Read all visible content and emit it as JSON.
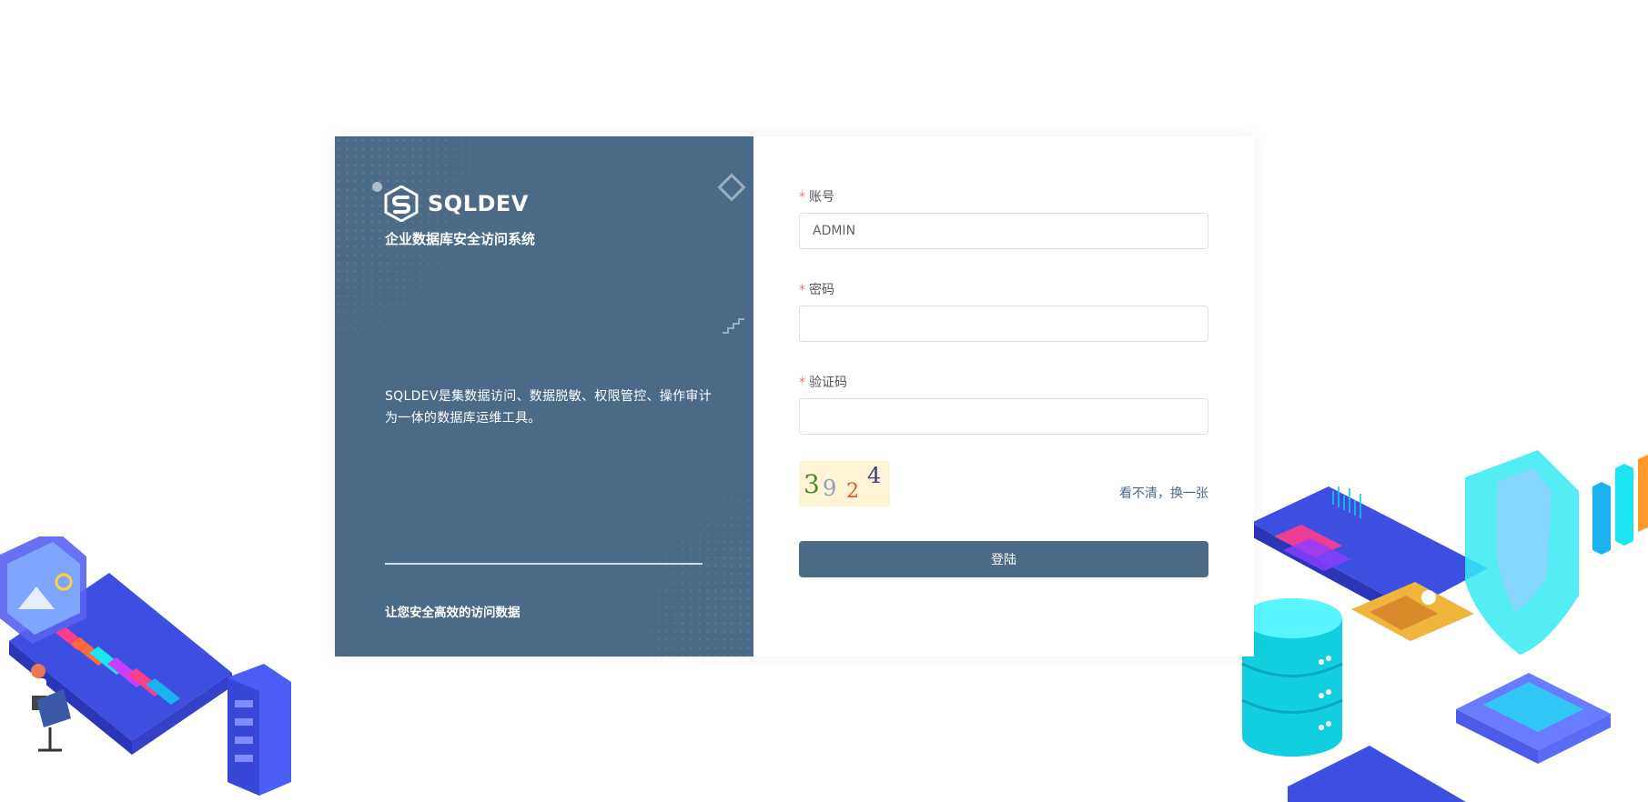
{
  "brand": {
    "name": "SQLDEV",
    "subtitle": "企业数据库安全访问系统",
    "description": "SQLDEV是集数据访问、数据脱敏、权限管控、操作审计为一体的数据库运维工具。",
    "slogan": "让您安全高效的访问数据"
  },
  "form": {
    "required_mark": "*",
    "account_label": "账号",
    "account_value": "ADMIN",
    "password_label": "密码",
    "password_value": "",
    "captcha_label": "验证码",
    "captcha_value": "",
    "captcha_text": "3924",
    "refresh_label": "看不清，换一张",
    "login_label": "登陆"
  },
  "colors": {
    "primary": "#4b6a87",
    "required": "#f56c6c",
    "illustration_blue": "#3d4fe0",
    "illustration_cyan": "#19e6f0"
  },
  "icons": {
    "logo": "hexagon-s-logo-icon"
  }
}
